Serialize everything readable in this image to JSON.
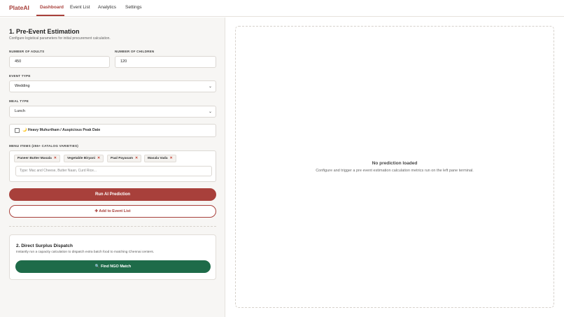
{
  "nav": {
    "brand": "PlateAI",
    "tabs": [
      {
        "label": "Dashboard",
        "active": true
      },
      {
        "label": "Event List",
        "active": false
      },
      {
        "label": "Analytics",
        "active": false
      },
      {
        "label": "Settings",
        "active": false
      }
    ]
  },
  "estimation": {
    "title": "1. Pre-Event Estimation",
    "subtitle": "Configure logistical parameters for initial procurement calculation.",
    "adults_label": "NUMBER OF ADULTS",
    "adults_value": "450",
    "children_label": "NUMBER OF CHILDREN",
    "children_value": "120",
    "event_type_label": "EVENT TYPE",
    "event_type_value": "Wedding",
    "meal_type_label": "MEAL TYPE",
    "meal_type_value": "Lunch",
    "muhurtham_label": "🌙 Heavy Muhurtham / Auspicious Peak Date",
    "muhurtham_checked": false,
    "menu_label": "MENU ITEMS (255+ CATALOG VARIETIES)",
    "menu_items": [
      "Paneer Butter Masala",
      "Vegetable Biryani",
      "Paal Payasam",
      "Masala Vada"
    ],
    "menu_placeholder": "Type: Mac and Cheese, Butter Naan, Curd Rice...",
    "run_button": "Run AI Prediction",
    "add_button": "Add to Event List"
  },
  "dispatch": {
    "title": "2. Direct Surplus Dispatch",
    "subtitle": "Instantly run a capacity calculation to dispatch extra batch food to matching Chennai centers.",
    "button": "Find NGO Match"
  },
  "result": {
    "empty_title": "No prediction loaded",
    "empty_subtitle": "Configure and trigger a pre event estimation calculation metrics run on the left pane terminal."
  },
  "colors": {
    "accent": "#a8403b",
    "green": "#1e6b49",
    "chip_remove": "#c0392b"
  }
}
